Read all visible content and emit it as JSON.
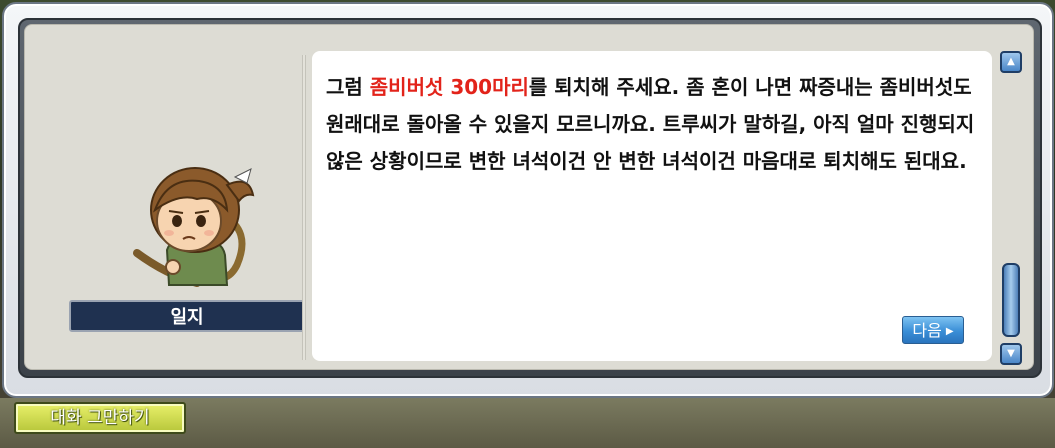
{
  "npc": {
    "name": "일지"
  },
  "dialog": {
    "pre": "그럼 ",
    "highlight": "좀비버섯 300마리",
    "post": "를 퇴치해 주세요. 좀 혼이 나면 짜증내는 좀비버섯도 원래대로 돌아올 수 있을지 모르니까요. 트루씨가 말하길, 아직 얼마 진행되지 않은 상황이므로 변한 녀석이건 안 변한 녀석이건 마음대로 퇴치해도 된대요.",
    "highlight_color": "#e2231a"
  },
  "buttons": {
    "next_label": "다음",
    "end_chat_label": "대화 그만하기"
  },
  "icons": {
    "next": "triangle-right-icon",
    "scroll_up": "scroll-up-icon",
    "scroll_down": "scroll-down-icon"
  }
}
